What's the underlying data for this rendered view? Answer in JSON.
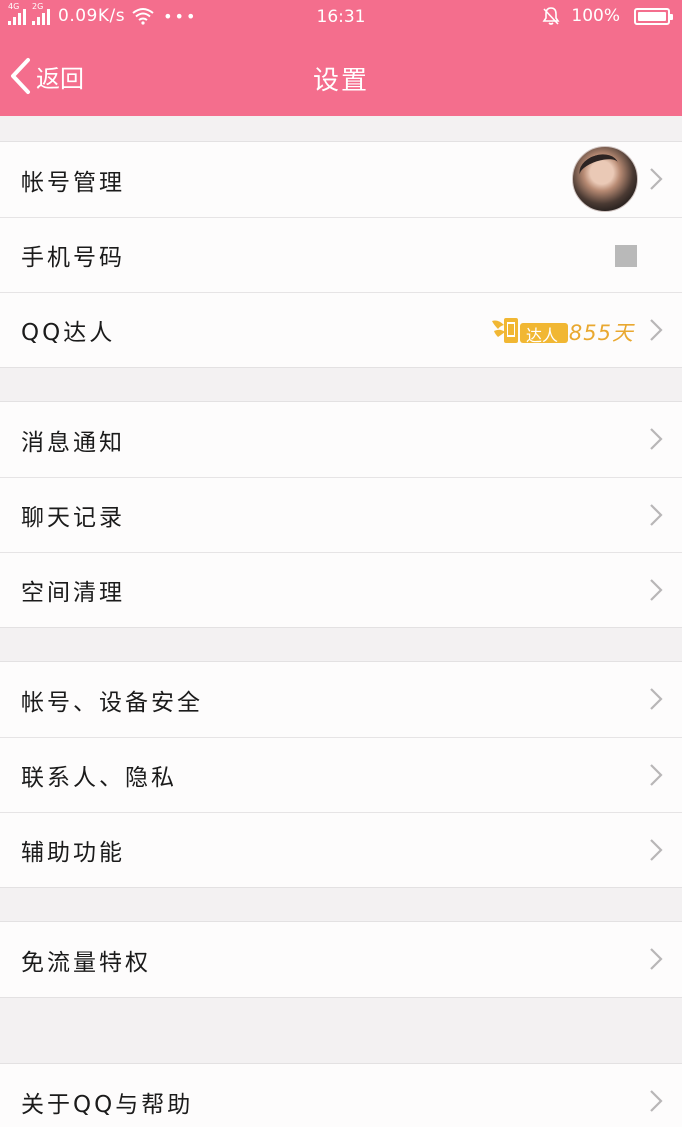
{
  "status_bar": {
    "network_1": "4G",
    "network_2": "2G",
    "speed": "0.09K/s",
    "more": "•••",
    "time": "16:31",
    "battery": "100%"
  },
  "nav": {
    "back_label": "返回",
    "title": "设置"
  },
  "groups": [
    {
      "items": [
        {
          "label": "帐号管理",
          "extra": "avatar"
        },
        {
          "label": "手机号码",
          "extra": "square"
        },
        {
          "label": "QQ达人",
          "extra": "badge",
          "badge_text": "达人",
          "days": "855天"
        }
      ]
    },
    {
      "items": [
        {
          "label": "消息通知"
        },
        {
          "label": "聊天记录"
        },
        {
          "label": "空间清理"
        }
      ]
    },
    {
      "items": [
        {
          "label": "帐号、设备安全"
        },
        {
          "label": "联系人、隐私"
        },
        {
          "label": "辅助功能"
        }
      ]
    },
    {
      "items": [
        {
          "label": "免流量特权"
        }
      ]
    },
    {
      "items": [
        {
          "label": "关于QQ与帮助"
        }
      ]
    }
  ],
  "colors": {
    "accent": "#f46e8d",
    "background": "#f3f1f2",
    "row": "#fdfcfc",
    "badge": "#f1b733",
    "days": "#e9a82f"
  }
}
